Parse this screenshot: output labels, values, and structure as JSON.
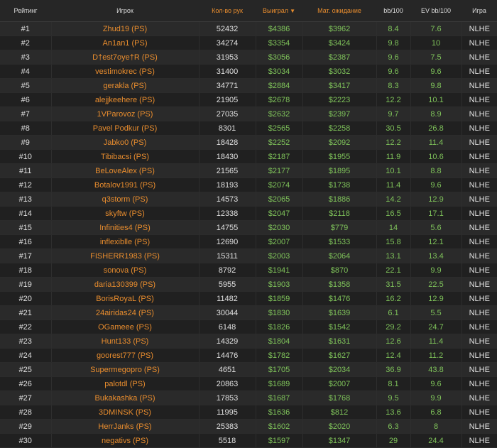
{
  "headers": {
    "rank": "Рейтинг",
    "player": "Игрок",
    "hands": "Кол-во рук",
    "won": "Выиграл",
    "sort_arrow": "▼",
    "ev": "Мат. ожидание",
    "bb100": "bb/100",
    "evbb100": "EV bb/100",
    "game": "Игра"
  },
  "colors": {
    "accent": "#e98d2e",
    "positive": "#7fc35a",
    "background": "#1f1f1f"
  },
  "rows": [
    {
      "rank": "#1",
      "player": "Zhud19 (PS)",
      "hands": "52432",
      "won": "$4386",
      "ev": "$3962",
      "bb100": "8.4",
      "evbb100": "7.6",
      "game": "NLHE"
    },
    {
      "rank": "#2",
      "player": "An1an1 (PS)",
      "hands": "34274",
      "won": "$3354",
      "ev": "$3424",
      "bb100": "9.8",
      "evbb100": "10",
      "game": "NLHE"
    },
    {
      "rank": "#3",
      "player": "D†est7oye†R (PS)",
      "hands": "31953",
      "won": "$3056",
      "ev": "$2387",
      "bb100": "9.6",
      "evbb100": "7.5",
      "game": "NLHE"
    },
    {
      "rank": "#4",
      "player": "vestimokrec (PS)",
      "hands": "31400",
      "won": "$3034",
      "ev": "$3032",
      "bb100": "9.6",
      "evbb100": "9.6",
      "game": "NLHE"
    },
    {
      "rank": "#5",
      "player": "gerakla (PS)",
      "hands": "34771",
      "won": "$2884",
      "ev": "$3417",
      "bb100": "8.3",
      "evbb100": "9.8",
      "game": "NLHE"
    },
    {
      "rank": "#6",
      "player": "alejjkeehere (PS)",
      "hands": "21905",
      "won": "$2678",
      "ev": "$2223",
      "bb100": "12.2",
      "evbb100": "10.1",
      "game": "NLHE"
    },
    {
      "rank": "#7",
      "player": "1VParovoz (PS)",
      "hands": "27035",
      "won": "$2632",
      "ev": "$2397",
      "bb100": "9.7",
      "evbb100": "8.9",
      "game": "NLHE"
    },
    {
      "rank": "#8",
      "player": "Pavel Podkur (PS)",
      "hands": "8301",
      "won": "$2565",
      "ev": "$2258",
      "bb100": "30.5",
      "evbb100": "26.8",
      "game": "NLHE"
    },
    {
      "rank": "#9",
      "player": "Jabko0 (PS)",
      "hands": "18428",
      "won": "$2252",
      "ev": "$2092",
      "bb100": "12.2",
      "evbb100": "11.4",
      "game": "NLHE"
    },
    {
      "rank": "#10",
      "player": "Tibibacsi (PS)",
      "hands": "18430",
      "won": "$2187",
      "ev": "$1955",
      "bb100": "11.9",
      "evbb100": "10.6",
      "game": "NLHE"
    },
    {
      "rank": "#11",
      "player": "BeLoveAlex (PS)",
      "hands": "21565",
      "won": "$2177",
      "ev": "$1895",
      "bb100": "10.1",
      "evbb100": "8.8",
      "game": "NLHE"
    },
    {
      "rank": "#12",
      "player": "Botalov1991 (PS)",
      "hands": "18193",
      "won": "$2074",
      "ev": "$1738",
      "bb100": "11.4",
      "evbb100": "9.6",
      "game": "NLHE"
    },
    {
      "rank": "#13",
      "player": "q3storm (PS)",
      "hands": "14573",
      "won": "$2065",
      "ev": "$1886",
      "bb100": "14.2",
      "evbb100": "12.9",
      "game": "NLHE"
    },
    {
      "rank": "#14",
      "player": "skyftw (PS)",
      "hands": "12338",
      "won": "$2047",
      "ev": "$2118",
      "bb100": "16.5",
      "evbb100": "17.1",
      "game": "NLHE"
    },
    {
      "rank": "#15",
      "player": "Infinities4 (PS)",
      "hands": "14755",
      "won": "$2030",
      "ev": "$779",
      "bb100": "14",
      "evbb100": "5.6",
      "game": "NLHE"
    },
    {
      "rank": "#16",
      "player": "inflexiblle (PS)",
      "hands": "12690",
      "won": "$2007",
      "ev": "$1533",
      "bb100": "15.8",
      "evbb100": "12.1",
      "game": "NLHE"
    },
    {
      "rank": "#17",
      "player": "FISHERR1983 (PS)",
      "hands": "15311",
      "won": "$2003",
      "ev": "$2064",
      "bb100": "13.1",
      "evbb100": "13.4",
      "game": "NLHE"
    },
    {
      "rank": "#18",
      "player": "sonova (PS)",
      "hands": "8792",
      "won": "$1941",
      "ev": "$870",
      "bb100": "22.1",
      "evbb100": "9.9",
      "game": "NLHE"
    },
    {
      "rank": "#19",
      "player": "daria130399 (PS)",
      "hands": "5955",
      "won": "$1903",
      "ev": "$1358",
      "bb100": "31.5",
      "evbb100": "22.5",
      "game": "NLHE"
    },
    {
      "rank": "#20",
      "player": "BorisRoyaL (PS)",
      "hands": "11482",
      "won": "$1859",
      "ev": "$1476",
      "bb100": "16.2",
      "evbb100": "12.9",
      "game": "NLHE"
    },
    {
      "rank": "#21",
      "player": "24airidas24 (PS)",
      "hands": "30044",
      "won": "$1830",
      "ev": "$1639",
      "bb100": "6.1",
      "evbb100": "5.5",
      "game": "NLHE"
    },
    {
      "rank": "#22",
      "player": "OGameee (PS)",
      "hands": "6148",
      "won": "$1826",
      "ev": "$1542",
      "bb100": "29.2",
      "evbb100": "24.7",
      "game": "NLHE"
    },
    {
      "rank": "#23",
      "player": "Hunt133 (PS)",
      "hands": "14329",
      "won": "$1804",
      "ev": "$1631",
      "bb100": "12.6",
      "evbb100": "11.4",
      "game": "NLHE"
    },
    {
      "rank": "#24",
      "player": "goorest777 (PS)",
      "hands": "14476",
      "won": "$1782",
      "ev": "$1627",
      "bb100": "12.4",
      "evbb100": "11.2",
      "game": "NLHE"
    },
    {
      "rank": "#25",
      "player": "Supermegopro (PS)",
      "hands": "4651",
      "won": "$1705",
      "ev": "$2034",
      "bb100": "36.9",
      "evbb100": "43.8",
      "game": "NLHE"
    },
    {
      "rank": "#26",
      "player": "palotdl (PS)",
      "hands": "20863",
      "won": "$1689",
      "ev": "$2007",
      "bb100": "8.1",
      "evbb100": "9.6",
      "game": "NLHE"
    },
    {
      "rank": "#27",
      "player": "Bukakashka (PS)",
      "hands": "17853",
      "won": "$1687",
      "ev": "$1768",
      "bb100": "9.5",
      "evbb100": "9.9",
      "game": "NLHE"
    },
    {
      "rank": "#28",
      "player": "3DMINSK (PS)",
      "hands": "11995",
      "won": "$1636",
      "ev": "$812",
      "bb100": "13.6",
      "evbb100": "6.8",
      "game": "NLHE"
    },
    {
      "rank": "#29",
      "player": "HerrJanks (PS)",
      "hands": "25383",
      "won": "$1602",
      "ev": "$2020",
      "bb100": "6.3",
      "evbb100": "8",
      "game": "NLHE"
    },
    {
      "rank": "#30",
      "player": "negativs (PS)",
      "hands": "5518",
      "won": "$1597",
      "ev": "$1347",
      "bb100": "29",
      "evbb100": "24.4",
      "game": "NLHE"
    }
  ]
}
